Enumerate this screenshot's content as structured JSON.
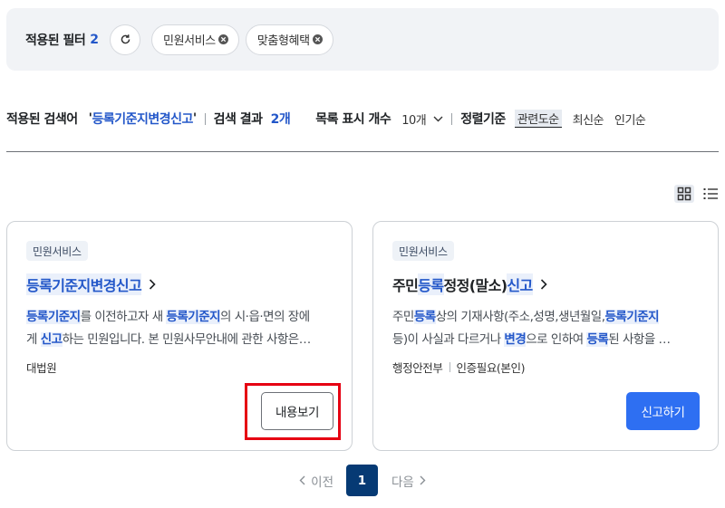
{
  "filters": {
    "title": "적용된 필터",
    "count": "2",
    "chips": [
      {
        "label": "민원서비스",
        "icon": "close-circle-icon"
      },
      {
        "label": "맞춤형혜택",
        "icon": "close-circle-icon"
      }
    ],
    "reset_icon": "refresh-icon"
  },
  "summary": {
    "applied_label": "적용된 검색어",
    "query_open": "'",
    "query": "등록기준지변경신고",
    "query_close": "'",
    "results_label": "검색 결과",
    "results_count": "2개",
    "list_count_label": "목록 표시 개수",
    "list_count_value": "10개",
    "sort_label": "정렬기준",
    "sort_options": [
      "관련도순",
      "최신순",
      "인기순"
    ],
    "sort_active": "관련도순"
  },
  "view": {
    "grid_icon": "grid-view-icon",
    "list_icon": "list-view-icon",
    "active": "grid"
  },
  "cards": [
    {
      "tag": "민원서비스",
      "title": "등록기준지변경신고",
      "desc_line1": [
        "등록기준지",
        "를 이전하고자 새 ",
        "등록기준지",
        "의 시·읍·면의 장에"
      ],
      "desc_line2": [
        "게 ",
        "신고",
        "하는 민원입니다. 본 민원사무안내에 관한 사항은…"
      ],
      "meta": [
        "대법원"
      ],
      "button": "내용보기"
    },
    {
      "tag": "민원서비스",
      "title_parts": [
        "주민",
        "등록",
        "정정(말소)",
        "신고"
      ],
      "desc_line1": [
        "주민",
        "등록",
        "상의 기재사항(주소,성명,생년월일,",
        "등록기준지"
      ],
      "desc_line2": [
        "등)이 사실과 다르거나 ",
        "변경",
        "으로 인하여 ",
        "등록",
        "된 사항을 …"
      ],
      "meta": [
        "행정안전부",
        "인증필요(본인)"
      ],
      "button": "신고하기"
    }
  ],
  "pagination": {
    "prev": "이전",
    "current": "1",
    "next": "다음"
  },
  "colors": {
    "accent": "#2357c9",
    "primary_button": "#2e6ff2",
    "page_active": "#063a74",
    "highlight_box": "#e60012"
  }
}
